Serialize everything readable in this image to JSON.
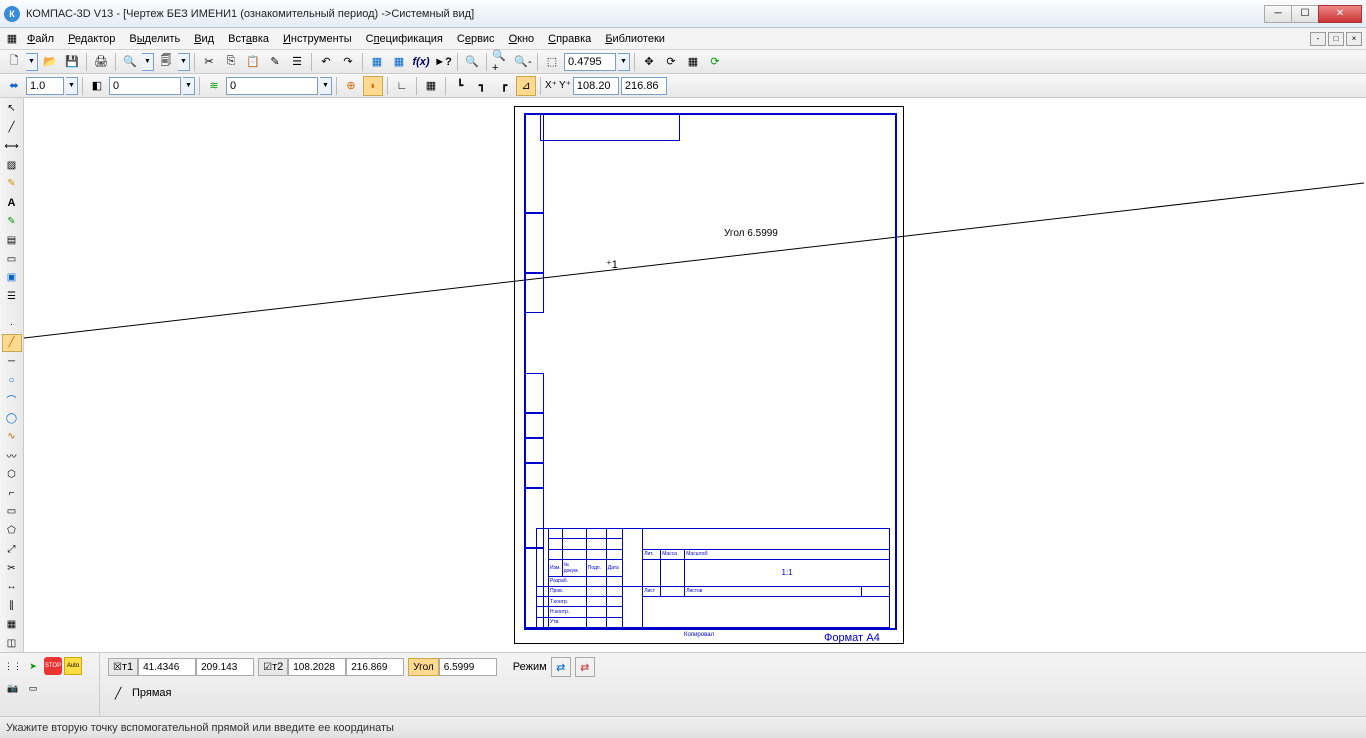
{
  "title": "КОМПАС-3D V13 - [Чертеж БЕЗ ИМЕНИ1 (ознакомительный период) ->Системный вид]",
  "menu": {
    "file": "Файл",
    "editor": "Редактор",
    "select": "Выделить",
    "view": "Вид",
    "insert": "Вставка",
    "tools": "Инструменты",
    "spec": "Спецификация",
    "service": "Сервис",
    "window": "Окно",
    "help": "Справка",
    "libs": "Библиотеки"
  },
  "tb1": {
    "zoom": "0.4795"
  },
  "tb2": {
    "step": "1.0",
    "style": "0",
    "layer": "0",
    "coord_x": "108.20",
    "coord_y": "216.86",
    "xt": "X⁺",
    "yt": "Y⁺"
  },
  "canvas": {
    "angle_label": "Угол 6.5999",
    "cursor": "⁺1"
  },
  "frame_labels": {
    "scale": "1:1",
    "format": "Формат",
    "a4": "A4",
    "kopir": "Копировал",
    "lit": "Лит.",
    "massa": "Масса",
    "masht": "Масштаб",
    "list": "Лист",
    "listov": "Листов",
    "izm": "Изм.",
    "list2": "Лист",
    "ndok": "№ докум.",
    "podp": "Подп.",
    "data": "Дата",
    "razrab": "Разраб.",
    "prov": "Пров.",
    "tkontr": "Т.контр.",
    "nkontr": "Н.контр.",
    "utv": "Утв."
  },
  "bottom": {
    "t1_label": "т1",
    "t1_x": "41.4346",
    "t1_y": "209.143",
    "t2_label": "т2",
    "t2_x": "108.2028",
    "t2_y": "216.869",
    "angle_label": "Угол",
    "angle": "6.5999",
    "rezhim": "Режим",
    "line": "Прямая"
  },
  "status": "Укажите вторую точку вспомогательной прямой или введите ее координаты",
  "icons": {
    "stop": "STOP",
    "auto": "Auto"
  }
}
